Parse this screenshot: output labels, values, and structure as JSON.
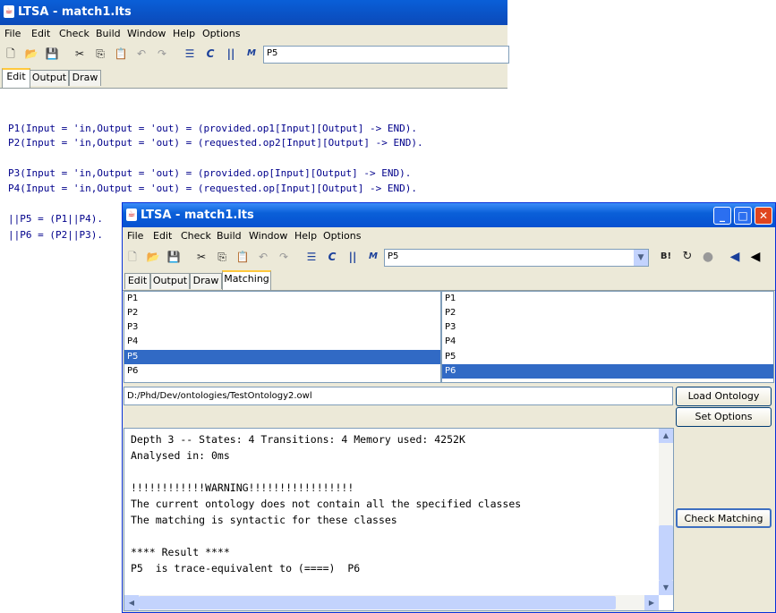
{
  "back_window": {
    "title": "LTSA - match1.lts",
    "menu": [
      "File",
      "Edit",
      "Check",
      "Build",
      "Window",
      "Help",
      "Options"
    ],
    "combo_value": "P5",
    "tabs": [
      "Edit",
      "Output",
      "Draw"
    ],
    "code_lines": [
      "P1(Input = 'in,Output = 'out) = (provided.op1[Input][Output] -> END).",
      "P2(Input = 'in,Output = 'out) = (requested.op2[Input][Output] -> END).",
      "P3(Input = 'in,Output = 'out) = (provided.op[Input][Output] -> END).",
      "P4(Input = 'in,Output = 'out) = (requested.op[Input][Output] -> END).",
      "||P5 = (P1||P4).",
      "||P6 = (P2||P3)."
    ]
  },
  "front_window": {
    "title": "LTSA - match1.lts",
    "menu": [
      "File",
      "Edit",
      "Check",
      "Build",
      "Window",
      "Help",
      "Options"
    ],
    "combo_value": "P5",
    "tabs": [
      "Edit",
      "Output",
      "Draw",
      "Matching"
    ],
    "left_list": [
      "P1",
      "P2",
      "P3",
      "P4",
      "P5",
      "P6"
    ],
    "right_list": [
      "P1",
      "P2",
      "P3",
      "P4",
      "P5",
      "P6"
    ],
    "left_selected": "P5",
    "right_selected": "P6",
    "ontology_path": "D:/Phd/Dev/ontologies/TestOntology2.owl",
    "load_ontology_label": "Load Ontology",
    "set_options_label": "Set Options",
    "check_matching_label": "Check Matching",
    "output_lines": [
      "Depth 3 -- States: 4 Transitions: 4 Memory used: 4252K",
      "Analysed in: 0ms",
      "",
      "!!!!!!!!!!!!WARNING!!!!!!!!!!!!!!!!!",
      "The current ontology does not contain all the specified classes",
      "The matching is syntactic for these classes",
      "",
      "**** Result ****",
      "P5  is trace-equivalent to (====)  P6"
    ]
  }
}
